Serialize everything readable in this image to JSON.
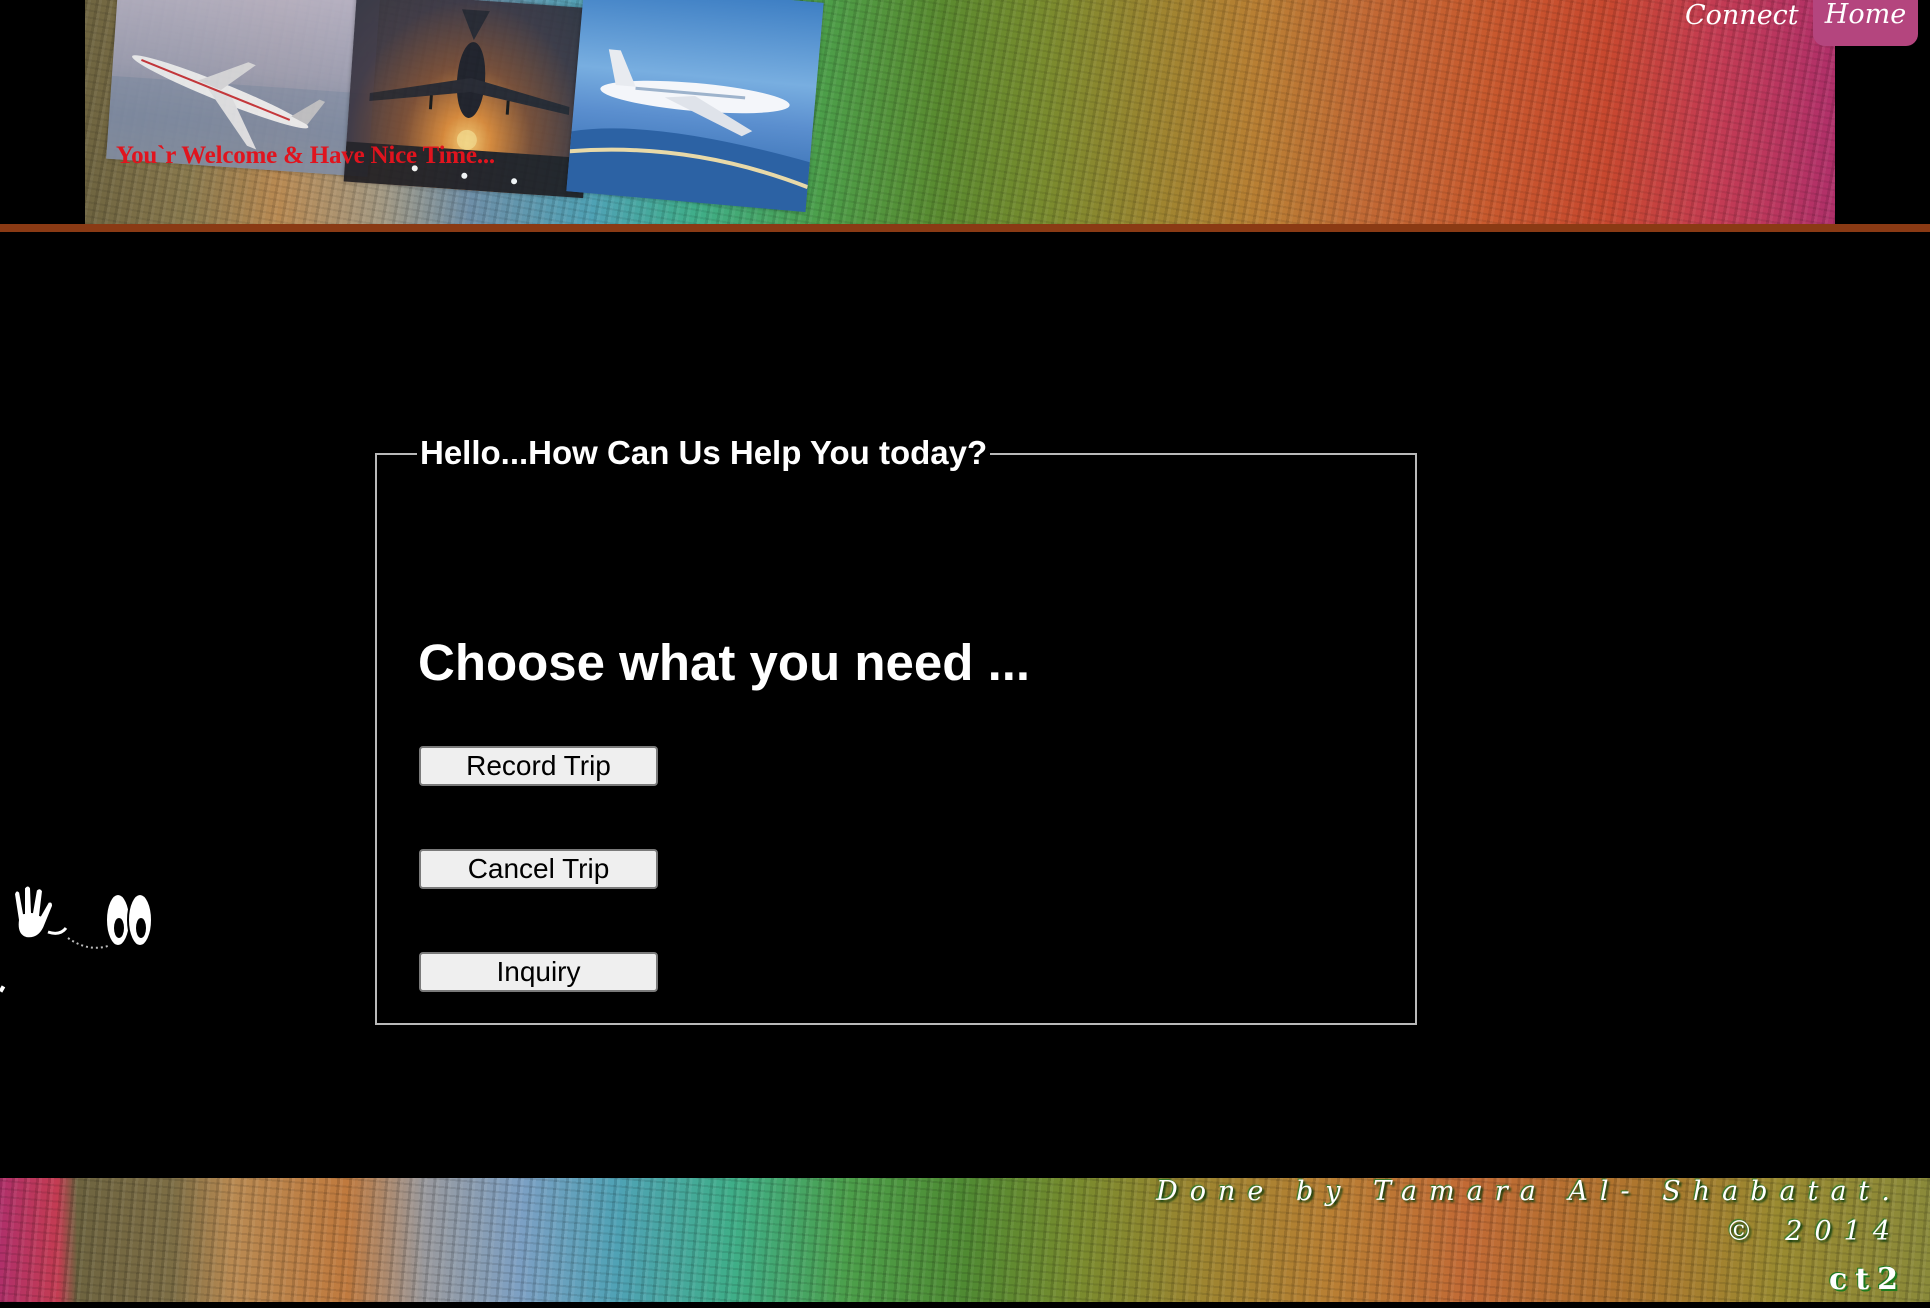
{
  "header": {
    "welcome_text": "You`r Welcome & Have Nice Time...",
    "nav": {
      "connect_label": "Connect",
      "home_label": "Home"
    },
    "photos": [
      "jet-over-water",
      "plane-landing-sunset",
      "airliner-blue-sky"
    ]
  },
  "main": {
    "legend": "Hello...How Can Us Help You today?",
    "heading": "Choose what you need ...",
    "buttons": {
      "record_trip": "Record Trip",
      "cancel_trip": "Cancel Trip",
      "inquiry": "Inquiry"
    }
  },
  "footer": {
    "author": "Done by Tamara Al- Shabatat.",
    "copyright": "© 2014",
    "code": "ct2"
  },
  "colors": {
    "page_background": "#000000",
    "welcome_text": "#e0141e",
    "home_tab": "#b4457e",
    "header_rule": "#8a3a14",
    "panel_border": "#b9b9b9",
    "button_face": "#efefef",
    "footer_text_shadow": "#1f7a1f"
  },
  "icons": {
    "cartoon": "waving-hand-and-eyes-icon"
  }
}
